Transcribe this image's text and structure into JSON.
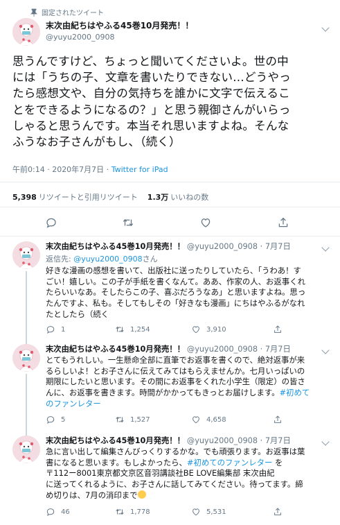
{
  "pinned_label": "固定されたツイート",
  "main_tweet": {
    "name": "末次由紀ちはやふる45巻10月発売！！",
    "handle": "@yuyu2000_0908",
    "text": "思うんですけど、ちょっと聞いてくださいよ。世の中\nには「うちの子、文章を書いたりできない…どうやっ\nたら感想文や、自分の気持ちを誰かに文字で伝えるこ\nとをできるようになるの？」と思う親御さんがいらっ\nしゃると思うんです。本当それ思いますよね。そんな\nふうなお子さんがもし、（続く）",
    "time": "午前0:14 · 2020年7月7日 · ",
    "client": "Twitter for iPad",
    "retweets": "5,398",
    "retweets_label": "リツイートと引用リツイート",
    "likes": "1.3万",
    "likes_label": "いいねの数"
  },
  "replies": [
    {
      "name": "末次由紀ちはやふる45巻10月発売！！",
      "handle": "@yuyu2000_0908 · 7月7日",
      "reply_to_prefix": "返信先: ",
      "reply_to_handle": "@yuyu2000_0908",
      "reply_to_suffix": "さん",
      "text": "好きな漫画の感想を書いて、出版社に送ったりしていたら、「うわあ！す\nごい！嬉しい。この子が手紙を書くなんて。ああ、作家の人、お返事くれ\nたらいいなあ。そしたらこの子、喜ぶだろうなあ」と思いますよね。思っ\nたんですよ、私も。そしてもしその「好きなも漫画」にちはやふるがなれ\nたとしたら（続く",
      "replies": "1",
      "retweets": "1,254",
      "likes": "3,910"
    },
    {
      "name": "末次由紀ちはやふる45巻10月発売！！",
      "handle": "@yuyu2000_0908 · 7月7日",
      "text_main": "とてもうれしい。一生懸命全部に直筆でお返事を書くので、絶対返事が来\nるらしいよ！とお子さんに伝えてみてはもらえませんか。七月いっぱいの\n期限にしたいと思います。その間にお返事をくれた小学生（限定）の皆さ\nんに、お返事を書きます。時間がかかってもきっとお届けします。",
      "hashtag_a": "#初めて",
      "hashtag_b": "のファンレター",
      "replies": "5",
      "retweets": "1,527",
      "likes": "4,658"
    },
    {
      "name": "末次由紀ちはやふる45巻10月発売！！",
      "handle": "@yuyu2000_0908 · 7月7日",
      "text_1": "急に言い出して編集さんびっくりするかな。でも頑張ります。お返事は葉\n書になると思います。もしよかったら、",
      "hashtag": "#初めてのファンレター",
      "text_2": " を\n〒112ー8001東京都文京区音羽講談社BE LOVE編集部 末次由紀\nに送ってくれるように、お子さんに話してみてください。待ってます。締\nめ切りは、7月の消印まで",
      "replies": "46",
      "retweets": "1,778",
      "likes": "5,531"
    }
  ],
  "colors": {
    "link": "#1b95e0",
    "secondary_text": "#657786",
    "divider": "#e6ecf0"
  },
  "icons": [
    "pin-icon",
    "caret-down-icon",
    "reply-icon",
    "retweet-icon",
    "like-icon",
    "share-icon",
    "avatar-image"
  ]
}
